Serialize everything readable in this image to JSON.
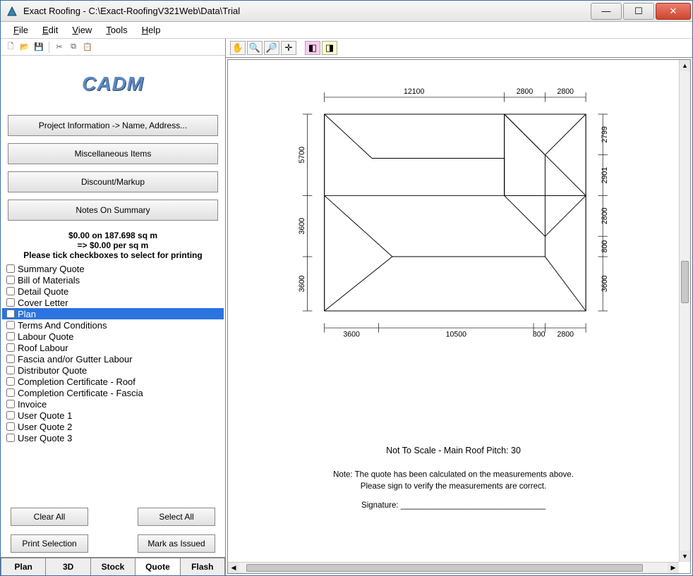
{
  "window": {
    "title": "Exact Roofing - C:\\Exact-RoofingV321Web\\Data\\Trial"
  },
  "menu": {
    "file": "File",
    "edit": "Edit",
    "view": "View",
    "tools": "Tools",
    "help": "Help"
  },
  "logo": "CADM",
  "big_buttons": {
    "project_info": "Project Information -> Name, Address...",
    "misc": "Miscellaneous Items",
    "discount": "Discount/Markup",
    "notes": "Notes On Summary"
  },
  "summary": {
    "line1": "$0.00 on 187.698 sq m",
    "line2": "=> $0.00 per sq m",
    "line3": "Please tick checkboxes to select for printing"
  },
  "checklist": [
    "Summary Quote",
    "Bill of Materials",
    "Detail Quote",
    "Cover Letter",
    "Plan",
    "Terms And Conditions",
    "Labour Quote",
    "Roof Labour",
    "Fascia and/or Gutter Labour",
    "Distributor Quote",
    "Completion Certificate - Roof",
    "Completion Certificate - Fascia",
    "Invoice",
    "User Quote 1",
    "User Quote 2",
    "User Quote 3"
  ],
  "selected_index": 4,
  "buttons": {
    "clear_all": "Clear All",
    "select_all": "Select All",
    "print_selection": "Print Selection",
    "mark_as_issued": "Mark as Issued"
  },
  "tabs": {
    "items": [
      "Plan",
      "3D",
      "Stock",
      "Quote",
      "Flash"
    ],
    "active": 3
  },
  "drawing": {
    "dims_top": {
      "a": "12100",
      "b": "2800",
      "c": "2800"
    },
    "dims_right": {
      "a": "2799",
      "b": "2901",
      "c": "2800",
      "d": "800",
      "e": "3600"
    },
    "dims_left": {
      "a": "5700",
      "b": "3600",
      "c": "3600"
    },
    "dims_bottom": {
      "a": "3600",
      "b": "10500",
      "c": "800",
      "d": "2800"
    },
    "scale_text": "Not To Scale - Main Roof Pitch: 30",
    "note_line1": "Note:  The quote has been calculated on the measurements above.",
    "note_line2": "Please sign to verify the measurements are correct.",
    "signature": "Signature: ________________________________"
  }
}
